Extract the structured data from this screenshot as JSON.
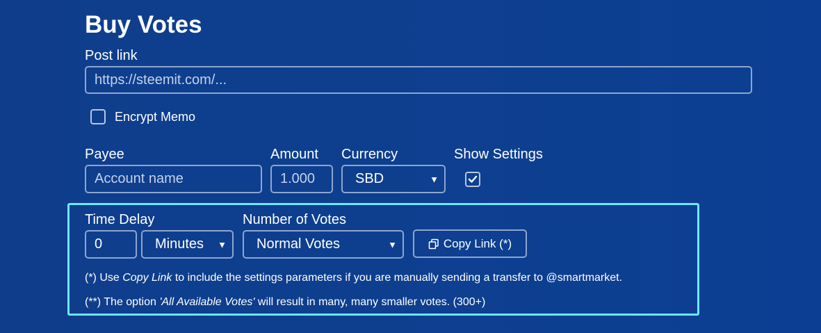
{
  "page": {
    "title": "Buy Votes"
  },
  "post_link": {
    "label": "Post link",
    "placeholder": "https://steemit.com/..."
  },
  "encrypt_memo": {
    "label": "Encrypt Memo",
    "checked": false
  },
  "payee": {
    "label": "Payee",
    "placeholder": "Account name"
  },
  "amount": {
    "label": "Amount",
    "placeholder": "1.000"
  },
  "currency": {
    "label": "Currency",
    "selected": "SBD"
  },
  "show_settings": {
    "label": "Show Settings",
    "checked": true
  },
  "time_delay": {
    "label": "Time Delay",
    "value": "0",
    "unit_selected": "Minutes"
  },
  "number_of_votes": {
    "label": "Number of Votes",
    "selected": "Normal Votes"
  },
  "copy_link": {
    "label": "Copy Link (*)",
    "icon": "copy-icon"
  },
  "notes": {
    "note1_prefix": "(*) Use ",
    "note1_emphasis": "Copy Link",
    "note1_suffix": " to include the settings parameters if you are manually sending a transfer to @smartmarket.",
    "note2_prefix": "(**) The option ",
    "note2_emphasis": "'All Available Votes'",
    "note2_suffix": " will result in many, many smaller votes. (300+)"
  },
  "colors": {
    "background": "#0e3f8f",
    "highlight_border": "#6ee8f5",
    "field_border": "#8fa6cf"
  }
}
